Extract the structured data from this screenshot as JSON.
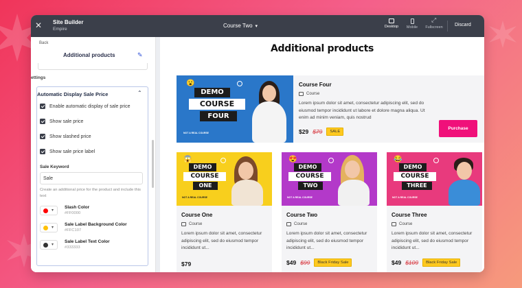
{
  "topbar": {
    "title": "Site Builder",
    "subtitle": "Empire",
    "page_selector": "Course Two",
    "devices": [
      {
        "label": "Desktop",
        "active": true
      },
      {
        "label": "Mobile",
        "active": false
      },
      {
        "label": "Fullscreen",
        "active": false
      }
    ],
    "discard_label": "Discard"
  },
  "sidebar": {
    "back_label": "Back",
    "heading": "Additional products",
    "settings_label": "ettings",
    "panel_title": "Automatic Display Sale Price",
    "checkboxes": [
      {
        "label": "Enable automatic display of sale price",
        "checked": true
      },
      {
        "label": "Show sale price",
        "checked": true
      },
      {
        "label": "Show slashed price",
        "checked": true
      },
      {
        "label": "Show sale price label",
        "checked": true
      }
    ],
    "sale_keyword_label": "Sale Keyword",
    "sale_keyword_value": "Sale",
    "sale_keyword_help": "Create an additional price for the product and include this text",
    "colors": [
      {
        "name": "Slash Color",
        "hex": "#FF0000",
        "swatch": "#ff0000"
      },
      {
        "name": "Sale Label Background Color",
        "hex": "#FFC107",
        "swatch": "#ffc107"
      },
      {
        "name": "Sale Label Text Color",
        "hex": "#333333",
        "swatch": "#333333"
      }
    ]
  },
  "preview": {
    "title": "Additional products",
    "featured": {
      "thumb_lines": [
        "DEMO",
        "COURSE",
        "FOUR"
      ],
      "thumb_caption": "NOT A REAL COURSE",
      "name": "Course Four",
      "type": "Course",
      "description": "Lorem ipsum dolor sit amet, consectetur adipiscing elit, sed do eiusmod tempor incididunt ut labore et dolore magna aliqua. Ut enim ad minim veniam, quis nostrud",
      "price": "$29",
      "old_price": "$79",
      "badge": "SALE",
      "button": "Purchase"
    },
    "cards": [
      {
        "thumb_lines": [
          "DEMO",
          "COURSE",
          "ONE"
        ],
        "thumb_caption": "NOT A REAL COURSE",
        "name": "Course One",
        "type": "Course",
        "description": "Lorem ipsum dolor sit amet, consectetur adipiscing elit, sed do eiusmod tempor incididunt ut...",
        "price": "$79",
        "old_price": "",
        "badge": ""
      },
      {
        "thumb_lines": [
          "DEMO",
          "COURSE",
          "TWO"
        ],
        "thumb_caption": "NOT A REAL COURSE",
        "name": "Course Two",
        "type": "Course",
        "description": "Lorem ipsum dolor sit amet, consectetur adipiscing elit, sed do eiusmod tempor incididunt ut...",
        "price": "$49",
        "old_price": "$99",
        "badge": "Black Friday Sale"
      },
      {
        "thumb_lines": [
          "DEMO",
          "COURSE",
          "THREE"
        ],
        "thumb_caption": "NOT A REAL COURSE",
        "name": "Course Three",
        "type": "Course",
        "description": "Lorem ipsum dolor sit amet, consectetur adipiscing elit, sed do eiusmod tempor incididunt ut...",
        "price": "$49",
        "old_price": "$109",
        "badge": "Black Friday Sale"
      }
    ]
  },
  "colors": {
    "topbar": "#3b3f4a",
    "accent_pink": "#f0107a",
    "link_blue": "#2c4fd8",
    "badge_yellow": "#ffc91f"
  }
}
